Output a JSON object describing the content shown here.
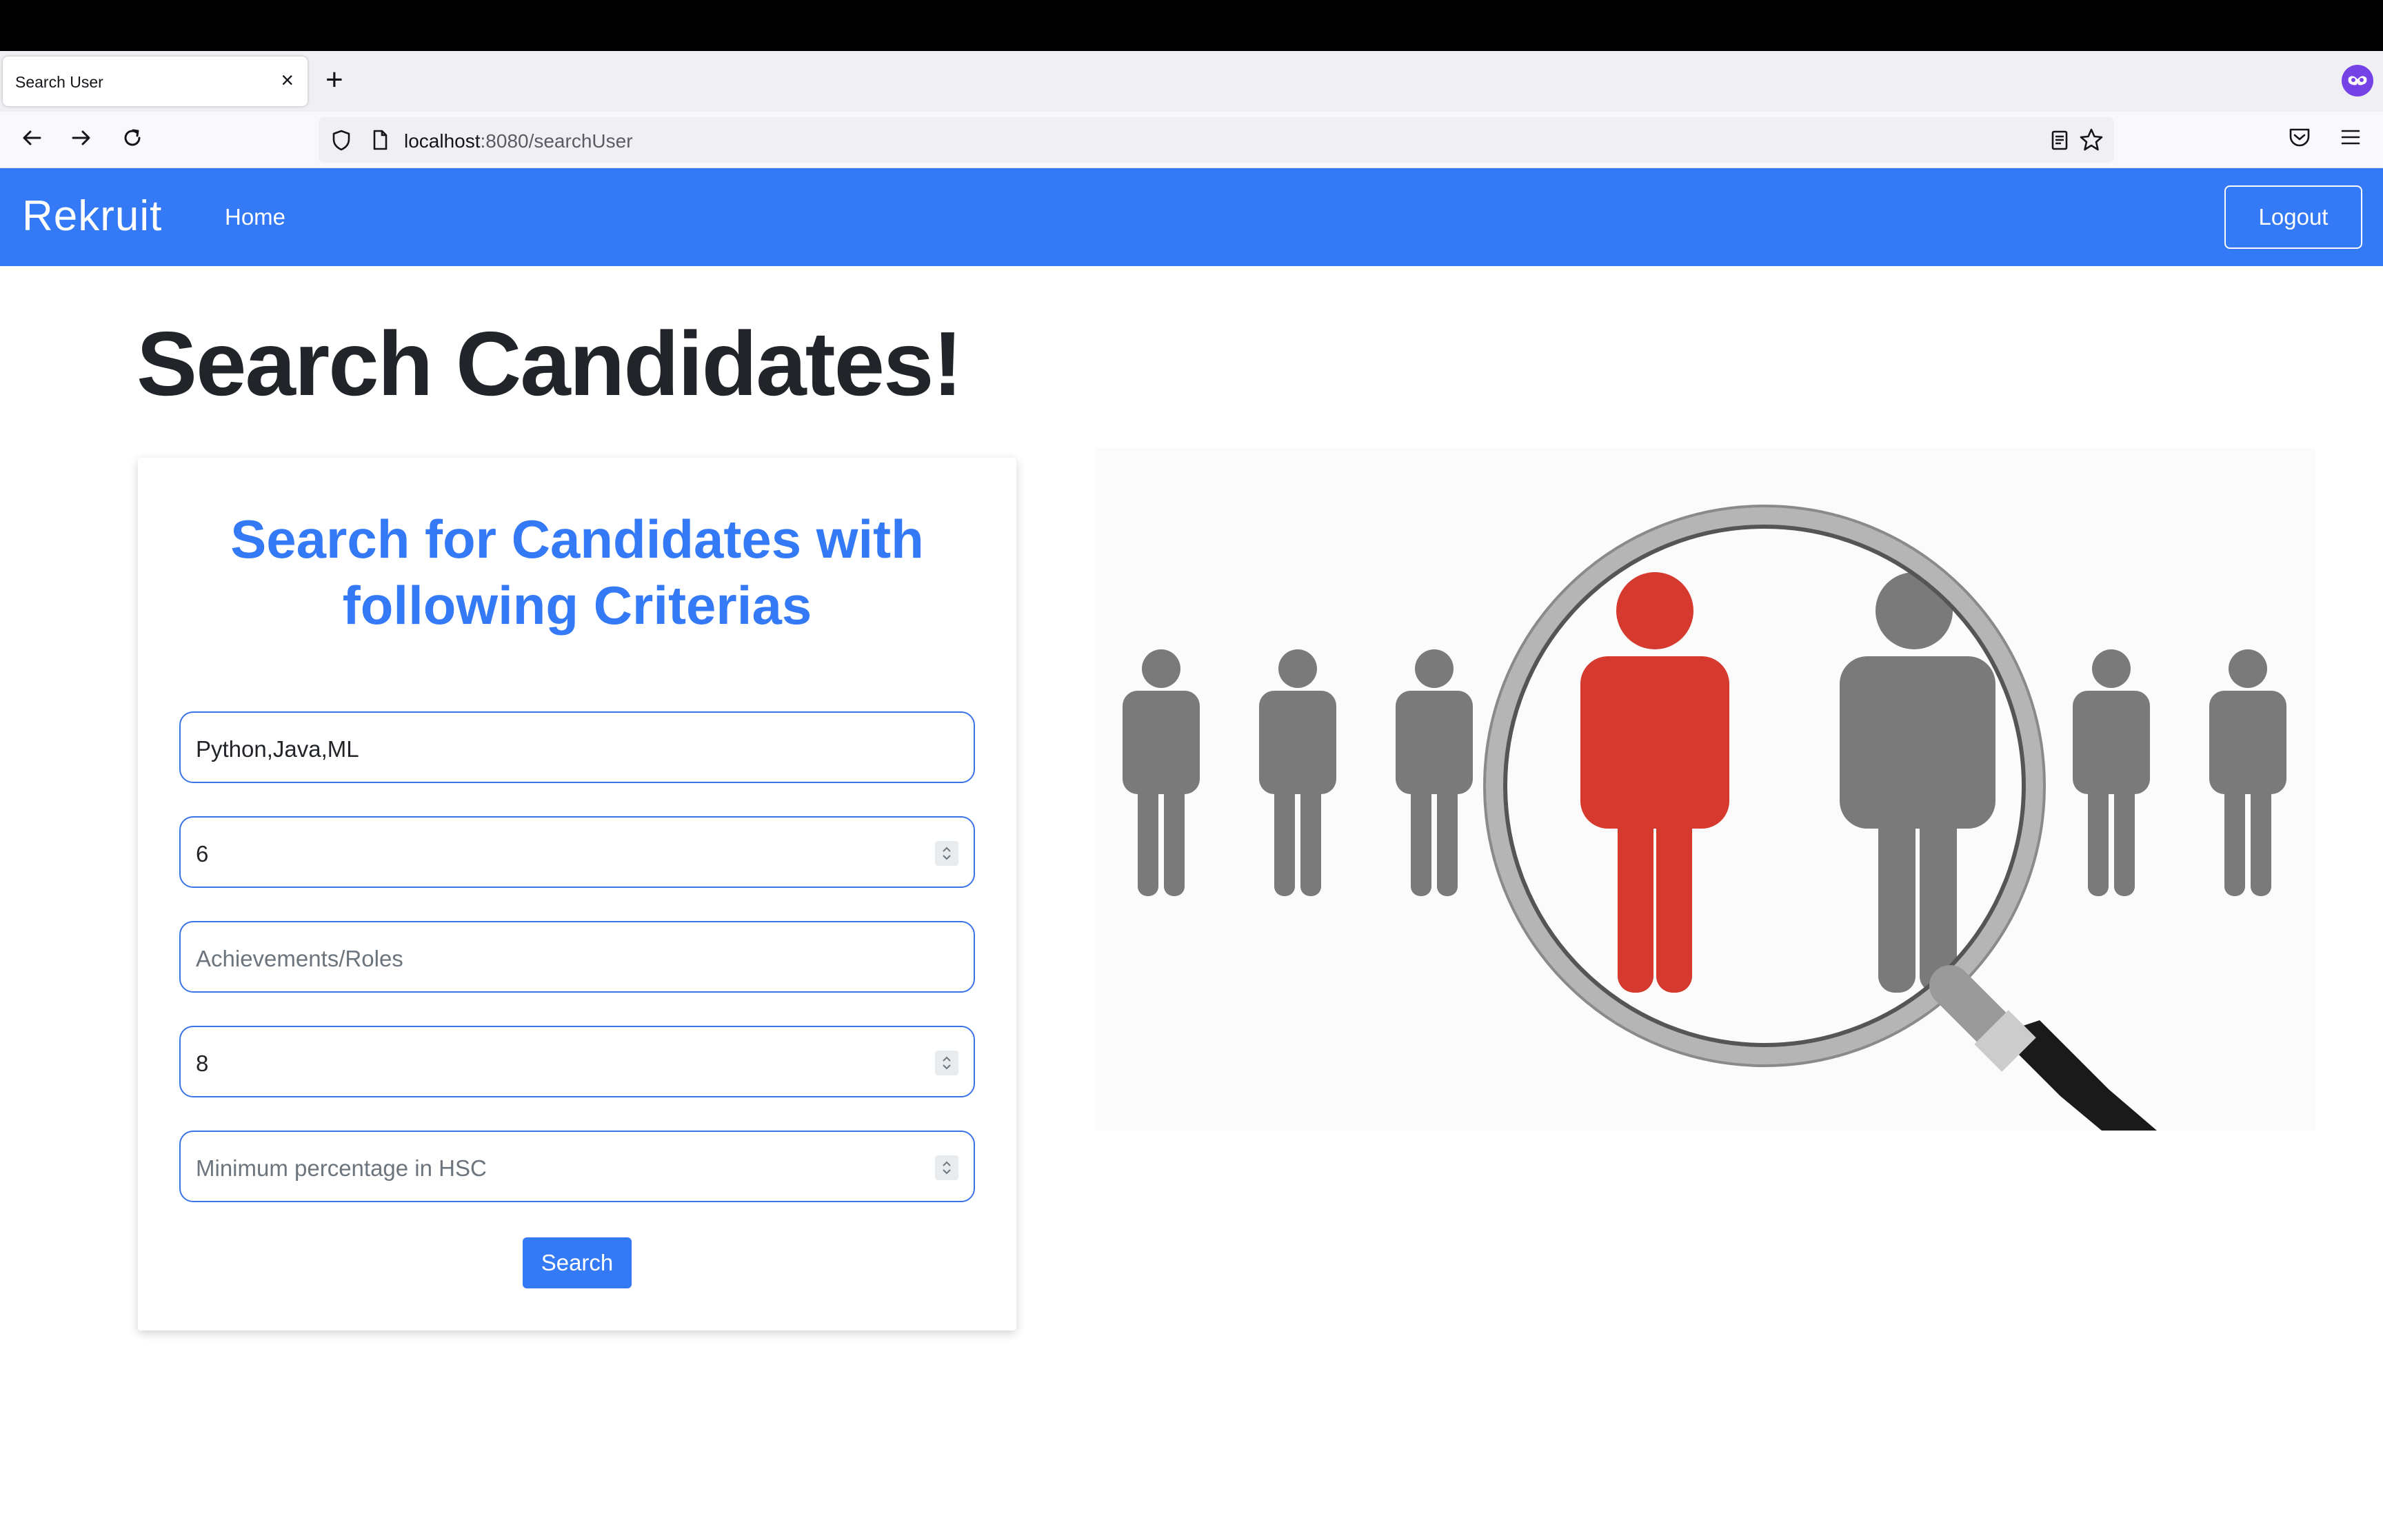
{
  "browser": {
    "tab_title": "Search User",
    "tab_close": "×",
    "new_tab": "+",
    "url_host": "localhost",
    "url_path": ":8080/searchUser"
  },
  "app": {
    "brand": "Rekruit",
    "nav_home": "Home",
    "logout": "Logout",
    "accent_color": "#3479f5"
  },
  "main": {
    "page_title": "Search Candidates!",
    "form_title": "Search for Candidates with following Criterias",
    "fields": [
      {
        "value": "Python,Java,ML",
        "placeholder": ""
      },
      {
        "value": "6",
        "placeholder": ""
      },
      {
        "value": "",
        "placeholder": "Achievements/Roles"
      },
      {
        "value": "8",
        "placeholder": ""
      },
      {
        "value": "",
        "placeholder": "Minimum percentage in HSC"
      }
    ],
    "search_button": "Search"
  }
}
